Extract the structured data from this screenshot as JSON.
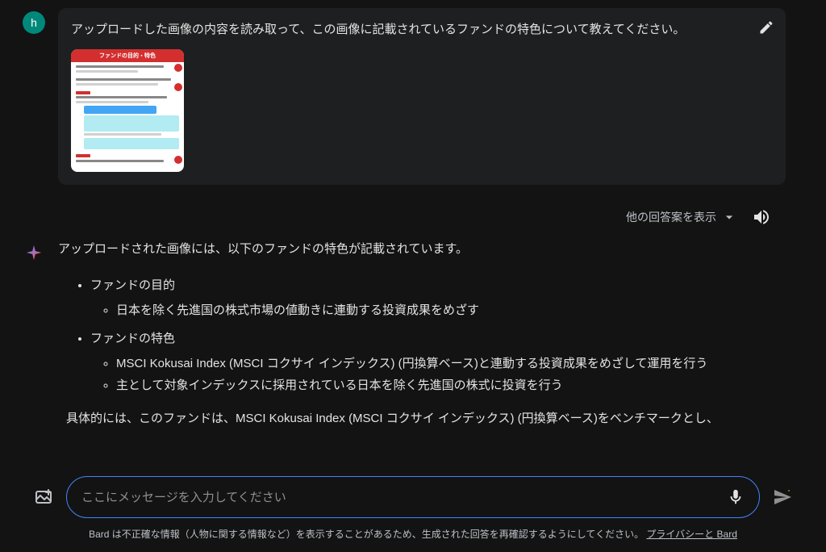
{
  "user": {
    "avatar_letter": "h",
    "message": "アップロードした画像の内容を読み取って、この画像に記載されているファンドの特色について教えてください。",
    "thumbnail_header": "ファンドの目的・特色"
  },
  "controls": {
    "view_drafts": "他の回答案を表示"
  },
  "response": {
    "intro": "アップロードされた画像には、以下のファンドの特色が記載されています。",
    "sections": [
      {
        "title": "ファンドの目的",
        "items": [
          "日本を除く先進国の株式市場の値動きに連動する投資成果をめざす"
        ]
      },
      {
        "title": "ファンドの特色",
        "items": [
          "MSCI Kokusai Index (MSCI コクサイ インデックス) (円換算ベース)と連動する投資成果をめざして運用を行う",
          "主として対象インデックスに採用されている日本を除く先進国の株式に投資を行う"
        ]
      }
    ],
    "continuation": "具体的には、このファンドは、MSCI Kokusai Index (MSCI コクサイ インデックス) (円換算ベース)をベンチマークとし、"
  },
  "input": {
    "placeholder": "ここにメッセージを入力してください"
  },
  "footer": {
    "disclaimer": "Bard は不正確な情報（人物に関する情報など）を表示することがあるため、生成された回答を再確認するようにしてください。",
    "link_text": "プライバシーと Bard"
  },
  "icons": {
    "edit": "edit",
    "chevron_down": "chevron-down",
    "speaker": "speaker",
    "image_upload": "image-upload",
    "mic": "mic",
    "send": "send"
  }
}
